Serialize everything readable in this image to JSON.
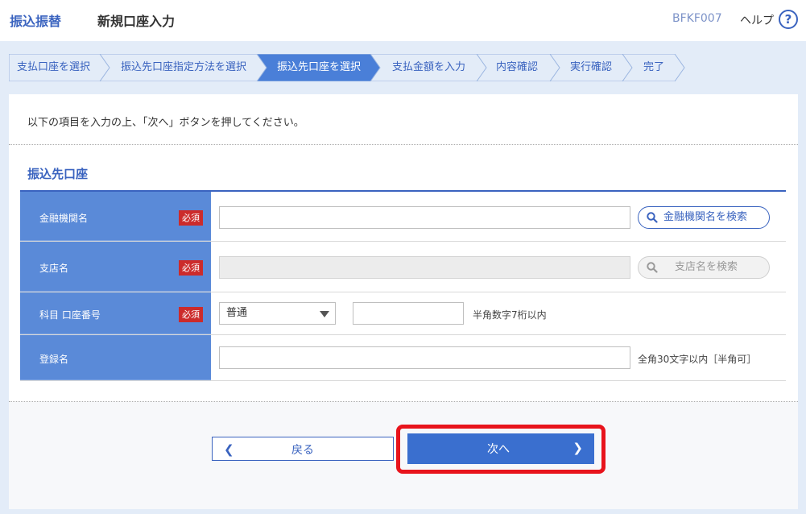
{
  "header": {
    "section": "振込振替",
    "title": "新規口座入力",
    "screen_id": "BFKF007",
    "help_label": "ヘルプ",
    "help_icon": "?"
  },
  "steps": [
    {
      "label": "支払口座を選択",
      "active": false
    },
    {
      "label": "振込先口座指定方法を選択",
      "active": false
    },
    {
      "label": "振込先口座を選択",
      "active": true
    },
    {
      "label": "支払金額を入力",
      "active": false
    },
    {
      "label": "内容確認",
      "active": false
    },
    {
      "label": "実行確認",
      "active": false
    },
    {
      "label": "完了",
      "active": false
    }
  ],
  "instruction": "以下の項目を入力の上、「次へ」ボタンを押してください。",
  "section_title": "振込先口座",
  "form": {
    "required_badge": "必須",
    "bank": {
      "label": "金融機関名",
      "value": "",
      "search_label": "金融機関名を検索"
    },
    "branch": {
      "label": "支店名",
      "value": "",
      "search_label": "支店名を検索"
    },
    "account": {
      "label": "科目 口座番号",
      "type_selected": "普通",
      "number_value": "",
      "hint": "半角数字7桁以内"
    },
    "registered_name": {
      "label": "登録名",
      "value": "",
      "hint": "全角30文字以内［半角可］"
    }
  },
  "buttons": {
    "back_label": "戻る",
    "next_label": "次へ"
  },
  "colors": {
    "accent": "#3a63bf",
    "label_bg": "#5a8ad8",
    "required": "#cc2b2b",
    "highlight": "#e8141c"
  }
}
